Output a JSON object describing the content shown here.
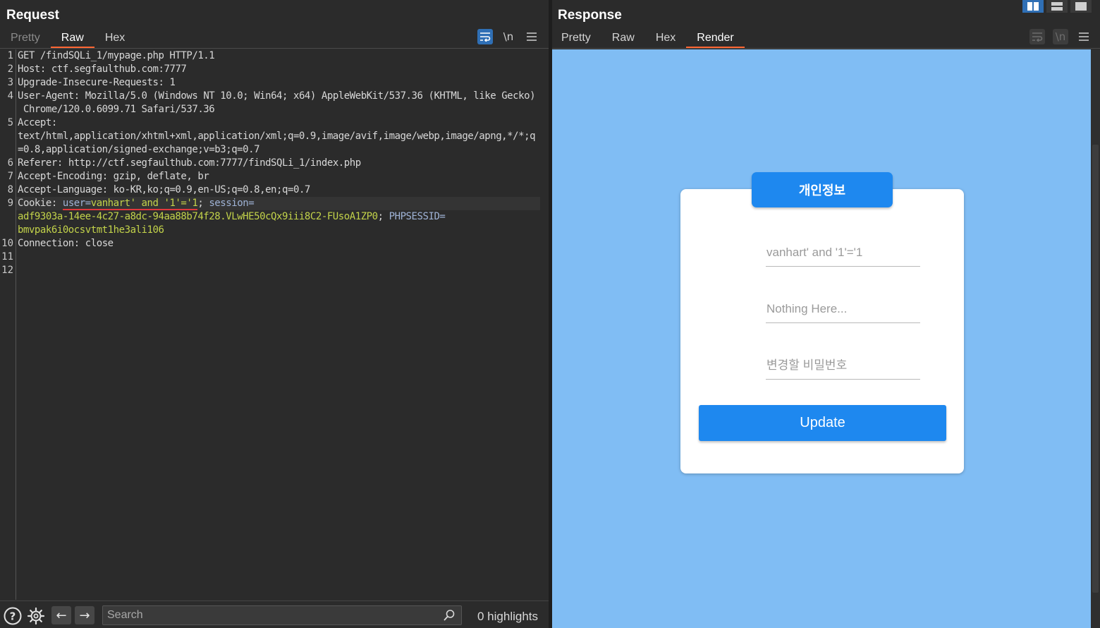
{
  "request": {
    "title": "Request",
    "tabs": [
      {
        "label": "Pretty",
        "state": "disabled"
      },
      {
        "label": "Raw",
        "state": "active"
      },
      {
        "label": "Hex",
        "state": "normal"
      }
    ],
    "toolbar": {
      "wrap_icon": "wrap-lines-icon",
      "newline_label": "\\n",
      "menu_icon": "hamburger-menu-icon"
    },
    "line_numbers": [
      "1",
      "2",
      "3",
      "4",
      "5",
      "6",
      "7",
      "8",
      "9",
      "10",
      "11",
      "12"
    ],
    "lines": {
      "l1": "GET /findSQLi_1/mypage.php HTTP/1.1",
      "l2_key": "Host",
      "l2_val": "ctf.segfaulthub.com:7777",
      "l3_key": "Upgrade-Insecure-Requests",
      "l3_val": "1",
      "l4_key": "User-Agent",
      "l4_val": "Mozilla/5.0 (Windows NT 10.0; Win64; x64) AppleWebKit/537.36 (KHTML, like Gecko)",
      "l4_cont": " Chrome/120.0.6099.71 Safari/537.36",
      "l5_key": "Accept",
      "l5_cont1": "text/html,application/xhtml+xml,application/xml;q=0.9,image/avif,image/webp,image/apng,*/*;q",
      "l5_cont2": "=0.8,application/signed-exchange;v=b3;q=0.7",
      "l6_key": "Referer",
      "l6_val": "http://ctf.segfaulthub.com:7777/findSQLi_1/index.php",
      "l7_key": "Accept-Encoding",
      "l7_val": "gzip, deflate, br",
      "l8_key": "Accept-Language",
      "l8_val": "ko-KR,ko;q=0.9,en-US;q=0.8,en;q=0.7",
      "l9_key": "Cookie",
      "l9_c1_name": "user",
      "l9_c1_value": "vanhart' and '1'='1",
      "l9_c2_name": "session",
      "l9_cont1_value": "adf9303a-14ee-4c27-a8dc-94aa88b74f28.VLwHE50cQx9iii8C2-FUsoA1ZP0",
      "l9_c3_name": "PHPSESSID",
      "l9_cont2_value": "bmvpak6i0ocsvtmt1he3ali106",
      "l10_key": "Connection",
      "l10_val": "close"
    },
    "bottom": {
      "search_placeholder": "Search",
      "search_value": "",
      "highlights": "0 highlights",
      "help_icon": "help-icon",
      "settings_icon": "gear-icon",
      "back_icon": "arrow-left-icon",
      "forward_icon": "arrow-right-icon"
    }
  },
  "response": {
    "title": "Response",
    "tabs": [
      {
        "label": "Pretty",
        "state": "normal"
      },
      {
        "label": "Raw",
        "state": "normal"
      },
      {
        "label": "Hex",
        "state": "normal"
      },
      {
        "label": "Render",
        "state": "active"
      }
    ],
    "layout_buttons": [
      "side-by-side-layout-icon",
      "stacked-layout-icon",
      "single-layout-icon"
    ],
    "rendered_page": {
      "background": "#80bdf4",
      "accent": "#1e88ef",
      "header": "개인정보",
      "fields": [
        {
          "placeholder": "vanhart' and '1'='1",
          "value": ""
        },
        {
          "placeholder": "Nothing Here...",
          "value": ""
        },
        {
          "placeholder": "변경할 비밀번호",
          "value": ""
        }
      ],
      "button": "Update"
    }
  }
}
